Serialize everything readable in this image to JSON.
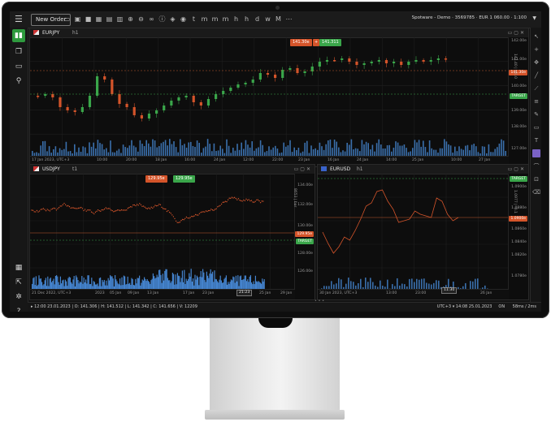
{
  "toolbar": {
    "new_order_label": "New Order",
    "more_label": "⋯",
    "account_label": "Spotware - Demo · 3569785 · EUR 1 060.00 · 1:100"
  },
  "charts": {
    "eurjpy": {
      "symbol": "EURJPY",
      "timeframe": "h1",
      "sell_price": "141.30e",
      "sell_change": "+",
      "buy_price": "141.311",
      "target_label": "TARGET",
      "price_tag": "141.30e",
      "vertical_label": "141.40 | +0.0",
      "price_ticks": [
        "142.00e",
        "141.00e",
        "140.00e",
        "139.00e",
        "138.00e",
        "127.00e"
      ],
      "time_ticks": [
        "17 Jan 2023, UTC+3",
        "10:00",
        "20:00",
        "18 Jan",
        "16:00",
        "24 Jan",
        "12:00",
        "22:00",
        "23 Jan",
        "16 Jan",
        "24 Jan",
        "14:00",
        "25 Jan",
        "10:00",
        "27 Jan"
      ]
    },
    "usdjpy": {
      "symbol": "USDJPY",
      "timeframe": "t1",
      "sell_price": "129.95e",
      "buy_price": "129.95e",
      "target_label": "TARGET",
      "price_tag": "129.95e",
      "vertical_label": "8653 | bar",
      "price_ticks": [
        "134.00e",
        "132.00e",
        "130.00e",
        "128.00e",
        "126.00e"
      ],
      "time_ticks": [
        "21 Dec 2022, UTC+3",
        "2023",
        "05 Jan",
        "09 Jan",
        "13 Jan",
        "17 Jan",
        "23 Jan",
        "25 Jan",
        "29 Jan"
      ],
      "crosshair_time": "21:23"
    },
    "eurusd": {
      "symbol": "EURUSD",
      "timeframe": "h1",
      "target_label": "TARGET",
      "price_tag": "1.0900e",
      "vertical_label": "1.0977 | -0.1",
      "price_ticks": [
        "1.0900e",
        "1.0880e",
        "1.0860e",
        "1.0840e",
        "1.0820e",
        "1.0780e"
      ],
      "time_ticks": [
        "30 Jan 2023, UTC+3",
        "13:00",
        "23:00",
        "26 Jan"
      ],
      "crosshair_time": "11:30"
    }
  },
  "status": {
    "ohlc": "▸ 12:00 23.01.2023 | O: 141.306 | H: 141.512 | L: 141.342 | C: 141.656 | V: 12209",
    "timezone": "UTC+3",
    "datetime": "14:08 25.01.2023",
    "toggle": "ON",
    "latency": "58ms / 2ms"
  },
  "colors": {
    "up_candle": "#3aa64a",
    "down_candle": "#d4542a",
    "volume": "#4a90e2",
    "line_series": "#d4542a"
  }
}
